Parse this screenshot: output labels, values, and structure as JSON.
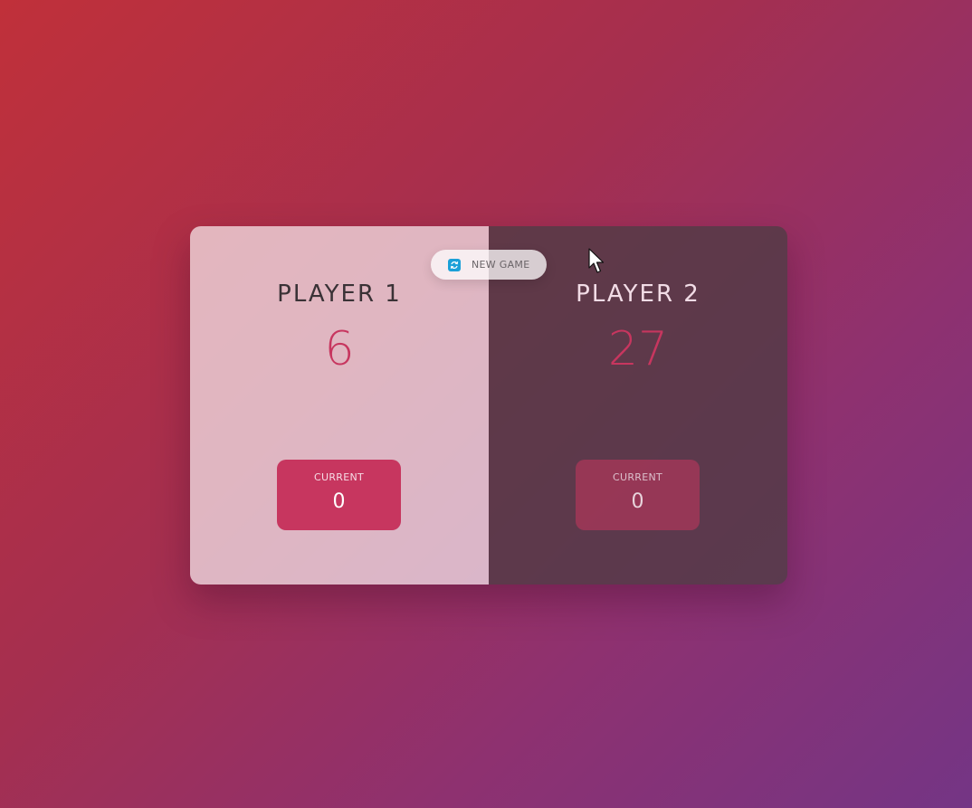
{
  "new_game_button": {
    "label": "NEW GAME",
    "icon": "refresh-icon"
  },
  "players": [
    {
      "name": "PLAYER 1",
      "score": "6",
      "current_label": "CURRENT",
      "current_score": "0",
      "active": true
    },
    {
      "name": "PLAYER 2",
      "score": "27",
      "current_label": "CURRENT",
      "current_score": "0",
      "active": false
    }
  ],
  "colors": {
    "accent": "#c7365f",
    "icon_blue": "#1ba0d8",
    "background_start": "#c0303a",
    "background_end": "#743585"
  }
}
